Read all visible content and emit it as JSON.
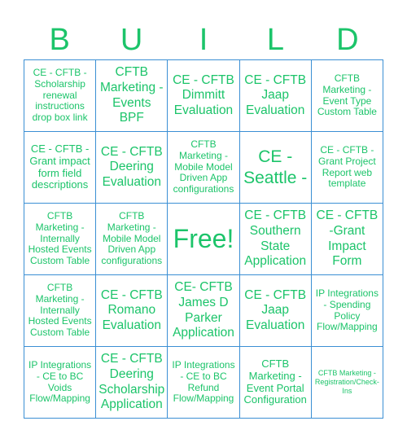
{
  "header": {
    "letters": [
      "B",
      "U",
      "I",
      "L",
      "D"
    ]
  },
  "colors": {
    "text": "#1cc46a",
    "grid": "#3b8fd4",
    "background": "#ffffff"
  },
  "board": {
    "rows": [
      [
        {
          "text": "CE - CFTB - Scholarship renewal instructions drop box link",
          "size": "s-sm"
        },
        {
          "text": "CFTB Marketing - Events BPF",
          "size": "s-lg"
        },
        {
          "text": "CE - CFTB Dimmitt Evaluation",
          "size": "s-lg"
        },
        {
          "text": "CE - CFTB Jaap Evaluation",
          "size": "s-lg"
        },
        {
          "text": "CFTB Marketing - Event Type Custom Table",
          "size": "s-sm"
        }
      ],
      [
        {
          "text": "CE - CFTB - Grant impact form field descriptions",
          "size": "s-md"
        },
        {
          "text": "CE - CFTB Deering Evaluation",
          "size": "s-lg"
        },
        {
          "text": "CFTB Marketing - Mobile Model Driven App configurations",
          "size": "s-sm"
        },
        {
          "text": "CE - Seattle -",
          "size": "s-xl"
        },
        {
          "text": "CE - CFTB - Grant Project Report web template",
          "size": "s-sm"
        }
      ],
      [
        {
          "text": "CFTB Marketing - Internally Hosted Events Custom Table",
          "size": "s-sm"
        },
        {
          "text": "CFTB Marketing - Mobile Model Driven App configurations",
          "size": "s-sm"
        },
        {
          "text": "Free!",
          "size": "s-free",
          "free": true
        },
        {
          "text": "CE - CFTB Southern State Application",
          "size": "s-lg"
        },
        {
          "text": "CE - CFTB -Grant Impact Form",
          "size": "s-lg"
        }
      ],
      [
        {
          "text": "CFTB Marketing - Internally Hosted Events Custom Table",
          "size": "s-sm"
        },
        {
          "text": "CE - CFTB Romano Evaluation",
          "size": "s-lg"
        },
        {
          "text": "CE- CFTB James D Parker Application",
          "size": "s-lg"
        },
        {
          "text": "CE - CFTB Jaap Evaluation",
          "size": "s-lg"
        },
        {
          "text": "IP Integrations - Spending Policy Flow/Mapping",
          "size": "s-sm"
        }
      ],
      [
        {
          "text": "IP Integrations - CE to BC Voids Flow/Mapping",
          "size": "s-sm"
        },
        {
          "text": "CE - CFTB Deering Scholarship Application",
          "size": "s-lg"
        },
        {
          "text": "IP Integrations - CE to BC Refund Flow/Mapping",
          "size": "s-sm"
        },
        {
          "text": "CFTB Marketing - Event Portal Configuration",
          "size": "s-md"
        },
        {
          "text": "CFTB Marketing - Registration/Check-Ins",
          "size": "s-xs"
        }
      ]
    ]
  }
}
